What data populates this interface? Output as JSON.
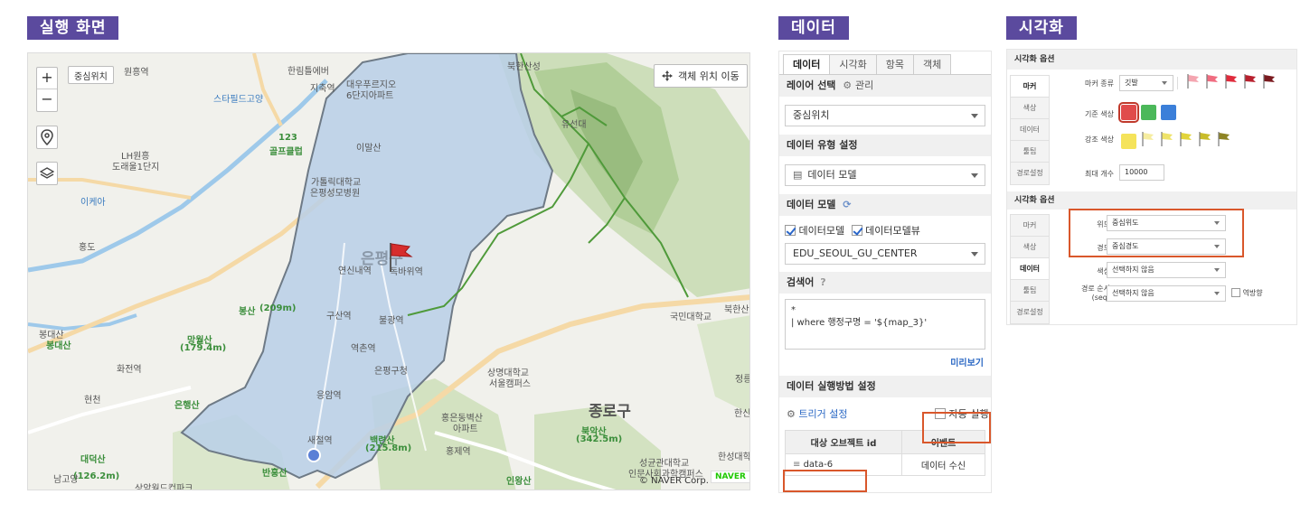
{
  "sections": {
    "run_screen": "실행 화면",
    "data": "데이터",
    "viz": "시각화"
  },
  "map": {
    "zoom_in": "+",
    "zoom_out": "−",
    "center_label": "중심위치",
    "move_object_button": "객체 위치 이동",
    "copyright": "© NAVER Corp.",
    "naver_logo": "NAVER",
    "place_labels": [
      "원흥역",
      "지축역",
      "한림틀에버",
      "대우푸르지오",
      "6단지아파트",
      "스타필드고양",
      "123",
      "골프클럽",
      "이말산",
      "LH원흥",
      "도래울1단지",
      "가톨릭대학교",
      "은평성모병원",
      "이케아",
      "홍도",
      "연신내역",
      "독바위역",
      "은평구",
      "유선대",
      "봉산",
      "(209m)",
      "구산역",
      "불광역",
      "봉대산",
      "봉대산",
      "망월산",
      "(179.4m)",
      "화전역",
      "역촌역",
      "은평구청",
      "상명대학교",
      "서울캠퍼스",
      "국민대학교",
      "북한산보",
      "정릉",
      "현천",
      "응암역",
      "은행산",
      "종로구",
      "홍은동벽산",
      "아파트",
      "북악산",
      "(342.5m)",
      "한신",
      "새절역",
      "백련산",
      "(215.8m)",
      "홍제역",
      "대덕산",
      "(126.2m)",
      "남고양",
      "반홍산",
      "성균관대학교",
      "인문사회과학캠퍼스",
      "인왕산",
      "(339.8m)",
      "한성대학교",
      "상암월드컵파크",
      "북한산성"
    ]
  },
  "data_panel": {
    "tabs": [
      "데이터",
      "시각화",
      "항목",
      "객체"
    ],
    "layer_select_title": "레이어 선택",
    "layer_manage": "관리",
    "layer_value": "중심위치",
    "data_type_title": "데이터 유형 설정",
    "data_type_value": "데이터 모델",
    "data_model_title": "데이터 모델",
    "check_model": "데이터모델",
    "check_model_view": "데이터모델뷰",
    "model_value": "EDU_SEOUL_GU_CENTER",
    "search_title": "검색어",
    "search_query_line1": "*",
    "search_query_line2": "| where 행정구명 = '${map_3}'",
    "preview_link": "미리보기",
    "exec_title": "데이터 실행방법 설정",
    "trigger_label": "트리거 설정",
    "auto_run_label": "자동 실행",
    "table_headers": [
      "대상 오브젝트 id",
      "이벤트"
    ],
    "table_row": {
      "id": "data-6",
      "event": "데이터 수신"
    }
  },
  "viz_panel": {
    "title1": "시각화 옵션",
    "tabs1": [
      "마커",
      "색상",
      "데이터",
      "툴팁",
      "경로설정"
    ],
    "marker_type_label": "마커 종류",
    "marker_type_value": "깃발",
    "base_color_label": "기준 색상",
    "accent_color_label": "강조 색상",
    "max_count_label": "최대 개수",
    "max_count_value": "10000",
    "title2": "시각화 옵션",
    "tabs2": [
      "마커",
      "색상",
      "데이터",
      "툴팁",
      "경로설정"
    ],
    "lat_label": "위도",
    "lat_value": "중심위도",
    "lng_label": "경도",
    "lng_value": "중심경도",
    "color_label": "색상",
    "color_value": "선택하지 않음",
    "route_label": "경로 순서",
    "route_label2": "(seq)",
    "route_value": "선택하지 않음",
    "reverse_label": "역방향",
    "colors": {
      "base": [
        "#e04b4b",
        "#4bb85a",
        "#3b7fd9"
      ],
      "accent": [
        "#f5e35a"
      ],
      "flags_red": [
        "#f4a5b0",
        "#f06c80",
        "#e02b3c",
        "#b8202e",
        "#7a1a1f"
      ],
      "flags_yellow": [
        "#f6eda0",
        "#efe36a",
        "#e2d43a",
        "#c9bc2a",
        "#8e8424"
      ]
    }
  }
}
